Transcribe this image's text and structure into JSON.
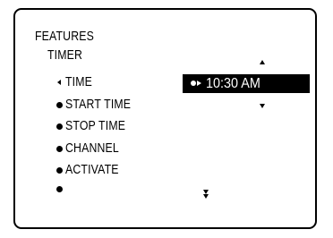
{
  "menu": {
    "title": "FEATURES",
    "submenu": "TIMER"
  },
  "items": [
    {
      "label": "TIME",
      "marker": "left-pointer",
      "selected": true
    },
    {
      "label": "START TIME",
      "marker": "bullet",
      "selected": false
    },
    {
      "label": "STOP TIME",
      "marker": "bullet",
      "selected": false
    },
    {
      "label": "CHANNEL",
      "marker": "bullet",
      "selected": false
    },
    {
      "label": "ACTIVATE",
      "marker": "bullet",
      "selected": false
    },
    {
      "label": "",
      "marker": "bullet",
      "selected": false
    }
  ],
  "value_field": {
    "value": "10:30 AM",
    "marker": "bullet-right-pointer",
    "up_indicator": "triangle-up-icon",
    "down_indicator": "triangle-down-icon"
  },
  "scroll_indicator": "double-chevron-down-icon",
  "colors": {
    "foreground": "#000000",
    "background": "#ffffff",
    "highlight_background": "#000000",
    "highlight_text": "#ffffff"
  }
}
